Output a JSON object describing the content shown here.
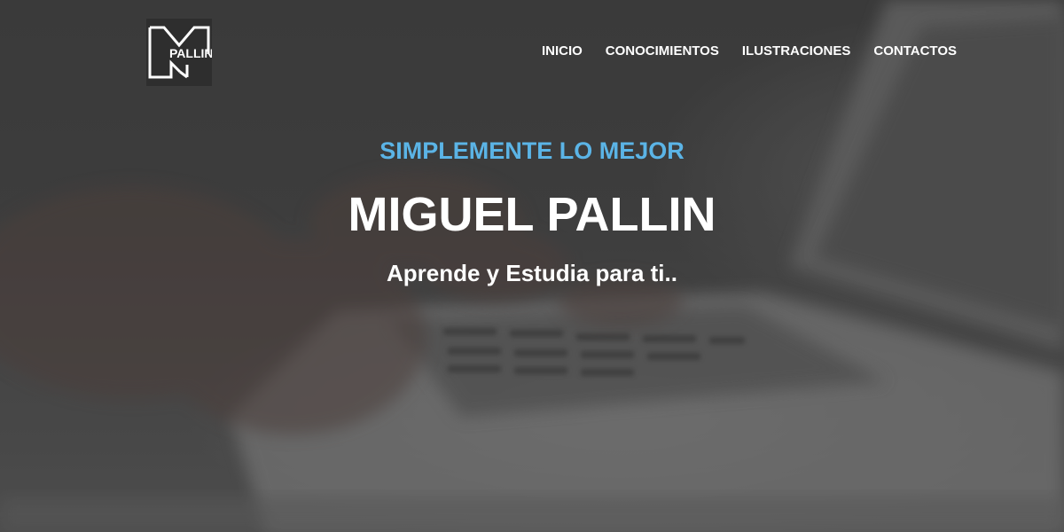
{
  "brand": {
    "logo_text": "PALLIN",
    "logo_letter": "M"
  },
  "nav": {
    "items": [
      {
        "label": "INICIO"
      },
      {
        "label": "CONOCIMIENTOS"
      },
      {
        "label": "ILUSTRACIONES"
      },
      {
        "label": "CONTACTOS"
      }
    ]
  },
  "hero": {
    "tagline": "SIMPLEMENTE LO MEJOR",
    "title": "MIGUEL PALLIN",
    "subtitle": "Aprende y Estudia para ti.."
  },
  "colors": {
    "accent": "#5bb4e6",
    "text": "#ffffff",
    "background": "#474747"
  }
}
